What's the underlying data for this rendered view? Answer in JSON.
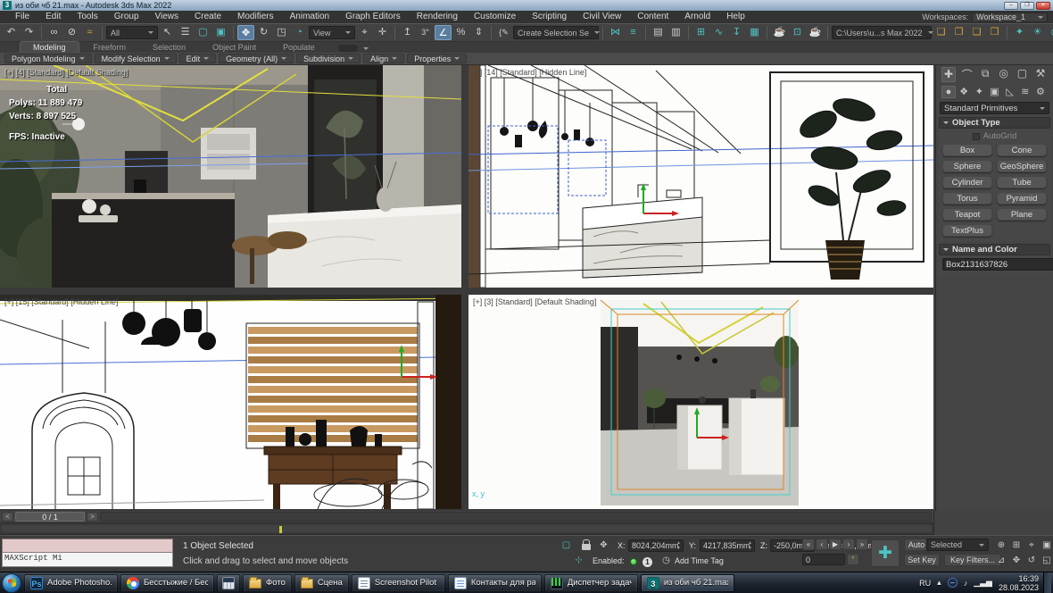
{
  "window": {
    "app_icon": "3",
    "title": "из оби чб 21.max - Autodesk 3ds Max 2022",
    "workspaces_label": "Workspaces:",
    "workspace_value": "Workspace_1",
    "min": "–",
    "max": "❐",
    "close": "✕"
  },
  "menus": [
    "File",
    "Edit",
    "Tools",
    "Group",
    "Views",
    "Create",
    "Modifiers",
    "Animation",
    "Graph Editors",
    "Rendering",
    "Customize",
    "Scripting",
    "Civil View",
    "Content",
    "Arnold",
    "Help"
  ],
  "toolbar": {
    "filter_value": "All",
    "coord_value": "View",
    "selection_set_value": "Create Selection Se",
    "project_path": "C:\\Users\\u...s Max 2022",
    "icons": [
      {
        "n": "undo-icon",
        "g": "↶"
      },
      {
        "n": "redo-icon",
        "g": "↷"
      },
      {
        "n": "select-and-link-icon",
        "g": "∞"
      },
      {
        "n": "unlink-selection-icon",
        "g": "⊘"
      },
      {
        "n": "bind-to-space-warp-icon",
        "g": "≈"
      },
      {
        "n": "select-object-icon",
        "g": "↖"
      },
      {
        "n": "select-by-name-icon",
        "g": "☰"
      },
      {
        "n": "rectangular-selection-icon",
        "g": "▢"
      },
      {
        "n": "window-crossing-icon",
        "g": "▣"
      },
      {
        "n": "select-and-move-icon",
        "g": "✥"
      },
      {
        "n": "select-and-rotate-icon",
        "g": "↻"
      },
      {
        "n": "select-and-scale-icon",
        "g": "◳"
      },
      {
        "n": "select-and-place-icon",
        "g": "◔"
      },
      {
        "n": "use-pivot-point-icon",
        "g": "⌖"
      },
      {
        "n": "select-and-manipulate-icon",
        "g": "✛"
      },
      {
        "n": "keyboard-override-icon",
        "g": "↥"
      },
      {
        "n": "snaps-toggle-icon",
        "g": "3°"
      },
      {
        "n": "angle-snap-icon",
        "g": "∠"
      },
      {
        "n": "percent-snap-icon",
        "g": "%"
      },
      {
        "n": "spinner-snap-icon",
        "g": "⇕"
      },
      {
        "n": "named-selection-sets-icon",
        "g": "{✎"
      },
      {
        "n": "mirror-icon",
        "g": "⋈"
      },
      {
        "n": "align-icon",
        "g": "≡"
      },
      {
        "n": "scene-explorer-icon",
        "g": "▤"
      },
      {
        "n": "layer-explorer-icon",
        "g": "▥"
      },
      {
        "n": "ribbon-toggle-icon",
        "g": "⊞"
      },
      {
        "n": "curve-editor-icon",
        "g": "∿"
      },
      {
        "n": "schematic-view-icon",
        "g": "↧"
      },
      {
        "n": "material-editor-icon",
        "g": "▦"
      },
      {
        "n": "render-setup-icon",
        "g": "☕"
      },
      {
        "n": "rendered-frame-icon",
        "g": "⊡"
      },
      {
        "n": "render-production-icon",
        "g": "☕"
      },
      {
        "n": "project-folder-icon-1",
        "g": "❏"
      },
      {
        "n": "project-folder-icon-2",
        "g": "❐"
      },
      {
        "n": "project-folder-icon-3",
        "g": "❑"
      },
      {
        "n": "project-folder-icon-4",
        "g": "❒"
      },
      {
        "n": "create-light-icon",
        "g": "✦"
      },
      {
        "n": "create-sun-icon",
        "g": "☀"
      },
      {
        "n": "create-camera-icon",
        "g": "◉"
      },
      {
        "n": "create-trees-icon",
        "g": "♣"
      },
      {
        "n": "create-image-icon",
        "g": "▦"
      },
      {
        "n": "create-tree-icon",
        "g": "♠"
      },
      {
        "n": "create-lamp-icon",
        "g": "♨"
      },
      {
        "n": "create-teapot-icon",
        "g": "☕"
      }
    ]
  },
  "ribbon": {
    "tabs": [
      "Modeling",
      "Freeform",
      "Selection",
      "Object Paint",
      "Populate"
    ],
    "panels": [
      "Polygon Modeling",
      "Modify Selection",
      "Edit",
      "Geometry (All)",
      "Subdivision",
      "Align",
      "Properties"
    ]
  },
  "viewports": {
    "top_left": {
      "label": "[+] [4] [Standard] [Default Shading]",
      "stats_total_label": "Total",
      "stats_polys": "Polys: 11 889 479",
      "stats_verts": "Verts: 8 897 525",
      "stats_fps": "FPS:    Inactive"
    },
    "top_right": {
      "label": "[+] [14] [Standard] [Hidden Line]"
    },
    "bottom_left": {
      "label": "[+] [15] [Standard] [Hidden Line]"
    },
    "bottom_right": {
      "label": "[+] [3] [Standard] [Default Shading]",
      "axis_label": "x, y"
    }
  },
  "command_panel": {
    "tab_icons": [
      {
        "n": "create-tab-icon",
        "g": "✚"
      },
      {
        "n": "modify-tab-icon",
        "g": "⌒"
      },
      {
        "n": "hierarchy-tab-icon",
        "g": "⧉"
      },
      {
        "n": "motion-tab-icon",
        "g": "◎"
      },
      {
        "n": "display-tab-icon",
        "g": "▢"
      },
      {
        "n": "utilities-tab-icon",
        "g": "⚒"
      }
    ],
    "category_icons": [
      {
        "n": "geometry-category-icon",
        "g": "●"
      },
      {
        "n": "shapes-category-icon",
        "g": "❖"
      },
      {
        "n": "lights-category-icon",
        "g": "✦"
      },
      {
        "n": "cameras-category-icon",
        "g": "▣"
      },
      {
        "n": "helpers-category-icon",
        "g": "◺"
      },
      {
        "n": "spacewarps-category-icon",
        "g": "≋"
      },
      {
        "n": "systems-category-icon",
        "g": "⚙"
      }
    ],
    "category_dropdown": "Standard Primitives",
    "object_type_rollout": "Object Type",
    "autogrid_label": "AutoGrid",
    "buttons": [
      "Box",
      "Cone",
      "Sphere",
      "GeoSphere",
      "Cylinder",
      "Tube",
      "Torus",
      "Pyramid",
      "Teapot",
      "Plane",
      "TextPlus"
    ],
    "name_color_rollout": "Name and Color",
    "object_name": "Box2131637826",
    "object_color": "#c24ad6"
  },
  "timeline": {
    "frame_indicator": "0 / 1",
    "prev": "<",
    "next": ">"
  },
  "status_bar": {
    "maxscript_text": "MAXScript Mi",
    "selection_info": "1 Object Selected",
    "prompt": "Click and drag to select and move objects",
    "x_label": "X:",
    "x_value": "8024,204mm",
    "y_label": "Y:",
    "y_value": "4217,835mm",
    "z_label": "Z:",
    "z_value": "-250,0mm",
    "grid_label": "Grid = 10,0mm",
    "enabled_label": "Enabled:",
    "notification_count": "1",
    "add_time_tag": "Add Time Tag",
    "frame_value": "0",
    "auto_key": "Auto Key",
    "set_key": "Set Key",
    "selected_dropdown": "Selected",
    "key_filters": "Key Filters...",
    "playback": [
      "«",
      "‹",
      "▶",
      "›",
      "»"
    ],
    "nav": [
      "⊕",
      "⊞",
      "⌖",
      "▣",
      "⊿",
      "✥",
      "↺",
      "◱"
    ]
  },
  "taskbar": {
    "items": [
      {
        "label": "Adobe Photosho...",
        "icon_text": "Ps"
      },
      {
        "label": "Бесстыжие / Бес..."
      },
      {
        "label": ""
      },
      {
        "label": "Фото"
      },
      {
        "label": "Сцена"
      },
      {
        "label": "Screenshot Pilot 1..."
      },
      {
        "label": "Контакты для ра..."
      },
      {
        "label": "Диспетчер задач ..."
      },
      {
        "label": "из оби чб 21.max...",
        "icon_text": "3"
      }
    ],
    "tray": {
      "lang": "RU",
      "arrow": "▴",
      "note": "♪",
      "bars": "▁▃▅",
      "time": "16:39",
      "date": "28.08.2023"
    }
  }
}
